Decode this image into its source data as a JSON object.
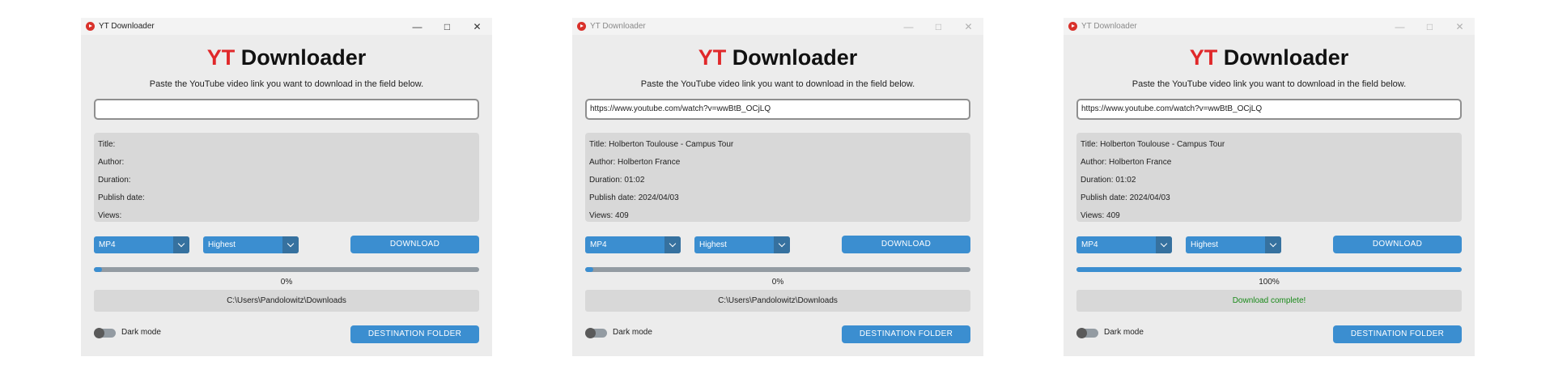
{
  "windows": [
    {
      "app_title": "YT Downloader",
      "heading_red": "YT",
      "heading_rest": " Downloader",
      "instruction": "Paste the YouTube video link you want to download in the field below.",
      "url_value": "",
      "info": {
        "title": "Title:",
        "author": "Author:",
        "duration": "Duration:",
        "publish_date": "Publish date:",
        "views": "Views:"
      },
      "format_select": "MP4",
      "quality_select": "Highest",
      "download_button": "DOWNLOAD",
      "progress_fraction": 0.02,
      "progress_text": "0%",
      "status_text": "C:\\Users\\Pandolowitz\\Downloads",
      "dark_mode_label": "Dark mode",
      "destination_button": "DESTINATION  FOLDER"
    },
    {
      "app_title": "YT Downloader",
      "heading_red": "YT",
      "heading_rest": " Downloader",
      "instruction": "Paste the YouTube video link you want to download in the field below.",
      "url_value": "https://www.youtube.com/watch?v=wwBtB_OCjLQ",
      "info": {
        "title": "Title: Holberton Toulouse - Campus Tour",
        "author": "Author: Holberton France",
        "duration": "Duration: 01:02",
        "publish_date": "Publish date: 2024/04/03",
        "views": "Views: 409"
      },
      "format_select": "MP4",
      "quality_select": "Highest",
      "download_button": "DOWNLOAD",
      "progress_fraction": 0.02,
      "progress_text": "0%",
      "status_text": "C:\\Users\\Pandolowitz\\Downloads",
      "dark_mode_label": "Dark mode",
      "destination_button": "DESTINATION  FOLDER"
    },
    {
      "app_title": "YT Downloader",
      "heading_red": "YT",
      "heading_rest": " Downloader",
      "instruction": "Paste the YouTube video link you want to download in the field below.",
      "url_value": "https://www.youtube.com/watch?v=wwBtB_OCjLQ",
      "info": {
        "title": "Title: Holberton Toulouse - Campus Tour",
        "author": "Author: Holberton France",
        "duration": "Duration: 01:02",
        "publish_date": "Publish date: 2024/04/03",
        "views": "Views: 409"
      },
      "format_select": "MP4",
      "quality_select": "Highest",
      "download_button": "DOWNLOAD",
      "progress_fraction": 1.0,
      "progress_text": "100%",
      "status_text": "Download complete!",
      "dark_mode_label": "Dark mode",
      "destination_button": "DESTINATION  FOLDER"
    }
  ],
  "window_controls": {
    "minimize": "—",
    "maximize": "□",
    "close": "✕"
  },
  "colors": {
    "accent": "#3b8ed0",
    "accent_dark": "#36719f",
    "brand_red": "#e0282a",
    "success": "#1a8a1a",
    "panel": "#d8d8d8",
    "window_bg": "#ececec"
  }
}
